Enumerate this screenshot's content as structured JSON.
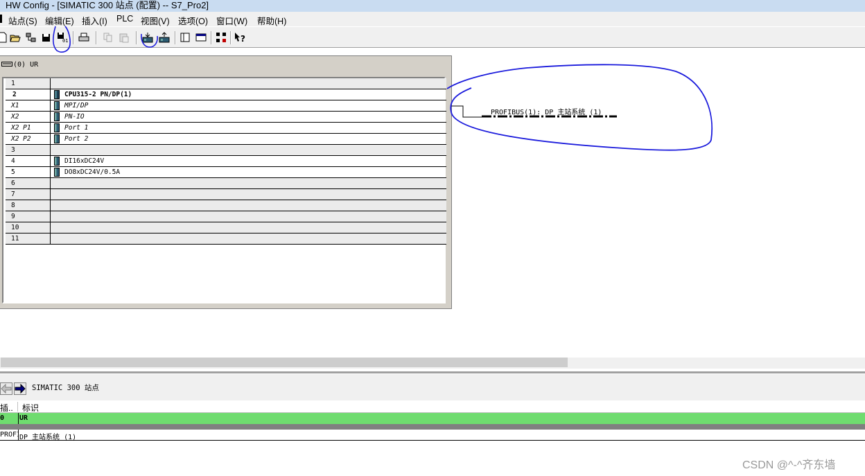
{
  "window": {
    "title": "HW Config - [SIMATIC 300 站点 (配置) -- S7_Pro2]"
  },
  "menu": [
    {
      "label": "站点(S)"
    },
    {
      "label": "编辑(E)"
    },
    {
      "label": "插入(I)"
    },
    {
      "label": "PLC"
    },
    {
      "label": "视图(V)"
    },
    {
      "label": "选项(O)"
    },
    {
      "label": "窗口(W)"
    },
    {
      "label": "帮助(H)"
    }
  ],
  "toolbar": {
    "icons": [
      "new-icon",
      "open-icon",
      "accessible-nodes-icon",
      "save-icon",
      "save-compile-icon",
      "print-icon",
      "copy-icon",
      "paste-icon",
      "download-icon",
      "upload-icon",
      "catalog-icon",
      "window-icon",
      "network-icon",
      "help-icon"
    ]
  },
  "rack": {
    "title": "(0) UR",
    "rows": [
      {
        "slot": "1",
        "module": ""
      },
      {
        "slot": "2",
        "module": "CPU315-2 PN/DP(1)"
      },
      {
        "slot": "X1",
        "module": "MPI/DP"
      },
      {
        "slot": "X2",
        "module": "PN-IO"
      },
      {
        "slot": "X2 P1",
        "module": "Port 1"
      },
      {
        "slot": "X2 P2",
        "module": "Port 2"
      },
      {
        "slot": "3",
        "module": ""
      },
      {
        "slot": "4",
        "module": "DI16xDC24V"
      },
      {
        "slot": "5",
        "module": "DO8xDC24V/0.5A"
      },
      {
        "slot": "6",
        "module": ""
      },
      {
        "slot": "7",
        "module": ""
      },
      {
        "slot": "8",
        "module": ""
      },
      {
        "slot": "9",
        "module": ""
      },
      {
        "slot": "10",
        "module": ""
      },
      {
        "slot": "11",
        "module": ""
      }
    ]
  },
  "network": {
    "profibus_label": "PROFIBUS(1): DP 主站系统 (1)"
  },
  "detail": {
    "title": "SIMATIC 300 站点",
    "columns": [
      "插..",
      "标识"
    ],
    "rows": [
      {
        "c1": "0",
        "c2": "UR"
      },
      {
        "c1": "",
        "c2": ""
      },
      {
        "c1": "PROFI",
        "c2": "DP 主站系统 (1)"
      }
    ]
  },
  "watermark": "CSDN @^-^齐东墙",
  "colors": {
    "titlebar": "#c9dcf1",
    "highlight_row": "#6fdc6f",
    "annotation": "#1a1adc"
  }
}
